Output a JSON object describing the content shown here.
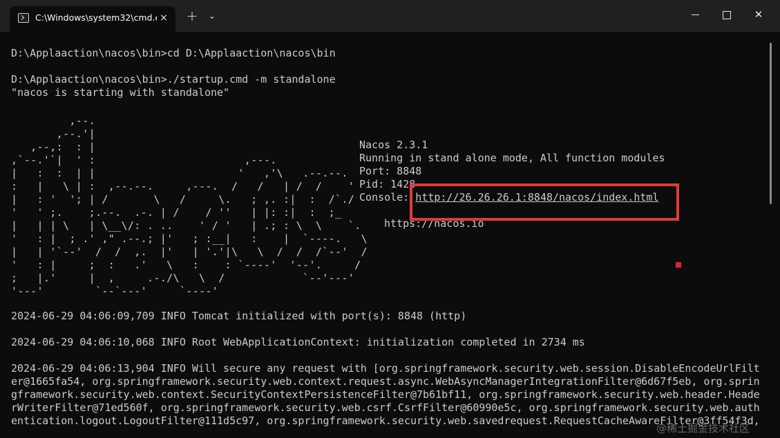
{
  "window": {
    "tab_title": "C:\\Windows\\system32\\cmd.e:",
    "tab_close": "×",
    "new_tab": "+",
    "dropdown": "⌄",
    "close_symbol": "✕"
  },
  "terminal": {
    "lines": [
      "D:\\Applaaction\\nacos\\bin>cd D:\\Applaaction\\nacos\\bin",
      "D:\\Applaaction\\nacos\\bin>./startup.cmd -m standalone",
      "\"nacos is starting with standalone\""
    ],
    "banner_art": "         ,--.\n       ,--.'|\n   ,--,:  : |                                           \n,`--.'`|  ' :                       ,---.               \n|   :  :  | |                      '   ,'\\   .--.--.    \n:   |   \\ | :  ,--.--.     ,---.  /   /   | /  /    '   \n|   : '  '; | /       \\   /     \\.   ; ,. :|  :  /`./   \n'   ' ;.    ;.--.  .-. | /    / ''   | |: :|  :  ;_     \n|   | | \\   | \\__\\/: . ..    ' / '   | .; : \\  \\    `.  \n'   : |  ; .' ,\" .--.; |'   ; :__|   :    |  `----.   \\ \n|   | '`--'  /  /  ,.  |'   | '.'|\\   \\  /  /  /`--'  / \n'   : |     ;  :   .'   \\   :    : `----'  '--'.     /  \n;   |.'     |  ,     .-./\\   \\  /            `--'---'   \n'---'        `--`---'     `----'",
    "info": {
      "version": "Nacos 2.3.1",
      "mode": "Running in stand alone mode, All function modules",
      "port": "Port: 8848",
      "pid": "Pid: 1428",
      "console_label": "Console: ",
      "console_url": "http://26.26.26.1:8848/nacos/index.html",
      "website": "https://nacos.io"
    },
    "logs": [
      "2024-06-29 04:06:09,709 INFO Tomcat initialized with port(s): 8848 (http)",
      "2024-06-29 04:06:10,068 INFO Root WebApplicationContext: initialization completed in 2734 ms"
    ],
    "security_log": [
      "2024-06-29 04:06:13,904 INFO Will secure any request with [org.springframework.security.web.session.DisableEncodeUrlFilt",
      "er@1665fa54, org.springframework.security.web.context.request.async.WebAsyncManagerIntegrationFilter@6d67f5eb, org.sprin",
      "gframework.security.web.context.SecurityContextPersistenceFilter@7b61bf11, org.springframework.security.web.header.Heade",
      "rWriterFilter@71ed560f, org.springframework.security.web.csrf.CsrfFilter@60990e5c, org.springframework.security.web.auth",
      "entication.logout.LogoutFilter@111d5c97, org.springframework.security.web.savedrequest.RequestCacheAwareFilter@3ff54f3d,"
    ]
  },
  "watermark": "@稀土掘金技术社区",
  "colors": {
    "terminal_bg": "#0c0c0c",
    "terminal_text": "#cccccc",
    "titlebar_bg": "#202020",
    "highlight": "#e23a3a"
  }
}
